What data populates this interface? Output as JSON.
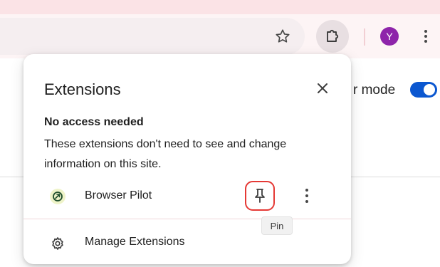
{
  "browser": {
    "avatar_letter": "Y",
    "avatar_color": "#8e24aa",
    "icons": [
      "star-icon",
      "puzzle-piece-icon",
      "more-vertical-icon"
    ]
  },
  "page": {
    "partial_text": "r mode",
    "toggle_on": true,
    "toggle_color": "#0b57d0"
  },
  "popup": {
    "title": "Extensions",
    "close_icon": "close-icon",
    "section_title": "No access needed",
    "section_desc": "These extensions don't need to see and change information on this site.",
    "extensions": [
      {
        "name": "Browser Pilot",
        "icon": "browser-pilot-logo-icon",
        "pinned": false
      }
    ],
    "manage_label": "Manage Extensions",
    "manage_icon": "gear-icon"
  },
  "tooltip": {
    "text": "Pin"
  },
  "highlight_color": "#e53935"
}
